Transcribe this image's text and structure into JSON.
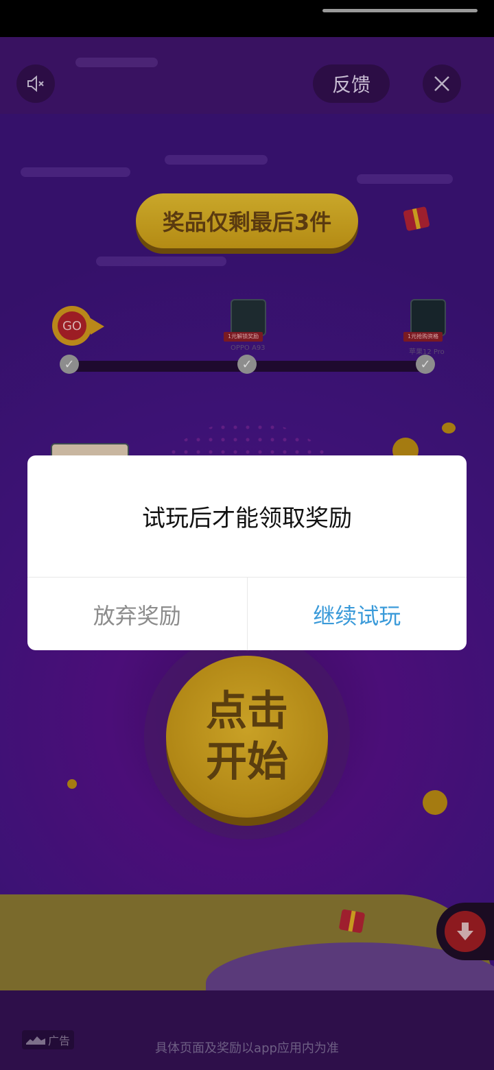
{
  "top_bar": {
    "feedback_label": "反馈",
    "mute_icon": "speaker-mute-icon",
    "close_icon": "close-icon"
  },
  "game": {
    "banner_text": "奖品仅剩最后3件",
    "go_label": "GO",
    "prizes": [
      {
        "tag": "1元解锁奖励",
        "name": "OPPO A93"
      },
      {
        "tag": "1元抢购资格",
        "name": "苹果12 Pro"
      }
    ],
    "start_button_label": "点击开始"
  },
  "dialog": {
    "message": "试玩后才能领取奖励",
    "cancel_label": "放弃奖励",
    "confirm_label": "继续试玩",
    "confirm_color": "#3a9ad9"
  },
  "footer": {
    "ad_label": "广告",
    "note": "具体页面及奖励以app应用内为准"
  },
  "colors": {
    "background": "#3d1275",
    "banner": "#c9a72a",
    "download": "#8d1a1f"
  }
}
